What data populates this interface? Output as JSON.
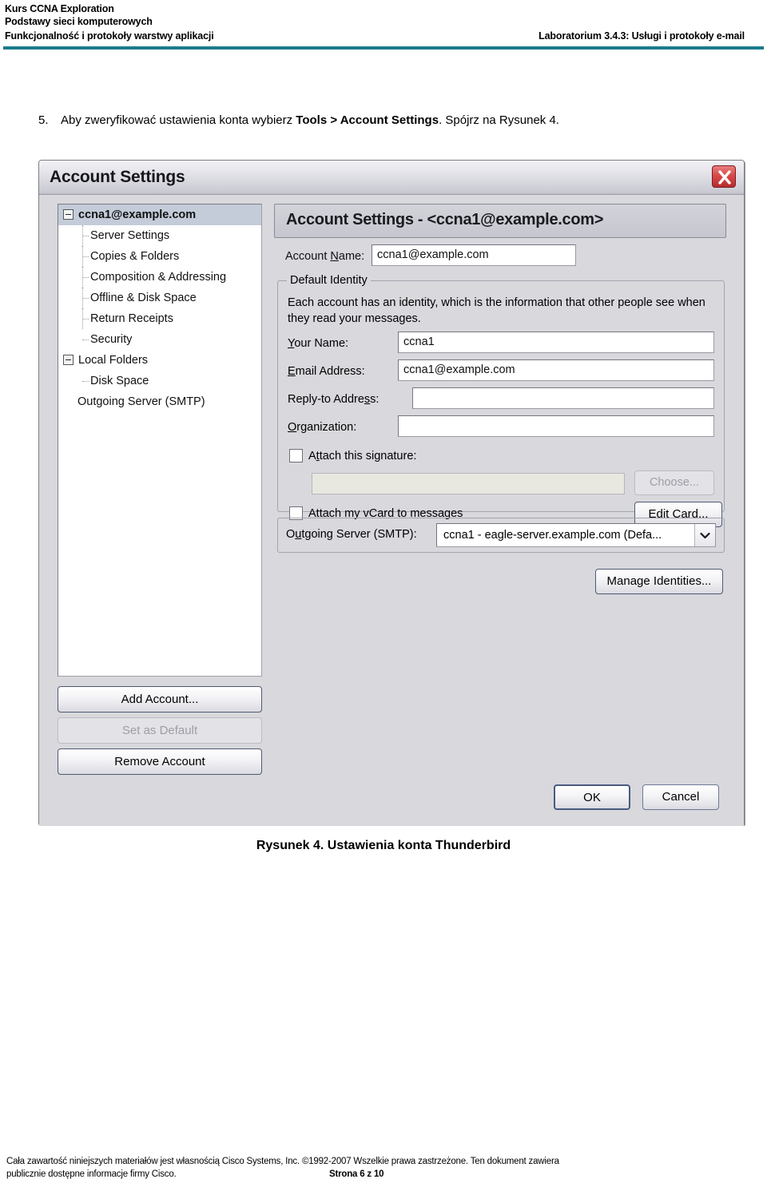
{
  "header": {
    "line1": "Kurs CCNA Exploration",
    "line2": "Podstawy sieci komputerowych",
    "line3": "Funkcjonalność i protokoły warstwy aplikacji",
    "right": "Laboratorium 3.4.3: Usługi i protokoły e-mail",
    "rule_color": "#1b7b8c"
  },
  "step": {
    "number": "5.",
    "text_before": "Aby zweryfikować ustawienia konta wybierz ",
    "emphasis": "Tools > Account Settings",
    "text_after": ". Spójrz na Rysunek 4."
  },
  "dialog": {
    "title": "Account Settings",
    "close_icon": "close-icon",
    "tree": {
      "items": [
        {
          "label": "ccna1@example.com",
          "level": 0,
          "expander": true,
          "selected": true
        },
        {
          "label": "Server Settings",
          "level": 1,
          "expander": false,
          "selected": false
        },
        {
          "label": "Copies & Folders",
          "level": 1,
          "expander": false,
          "selected": false
        },
        {
          "label": "Composition & Addressing",
          "level": 1,
          "expander": false,
          "selected": false
        },
        {
          "label": "Offline & Disk Space",
          "level": 1,
          "expander": false,
          "selected": false
        },
        {
          "label": "Return Receipts",
          "level": 1,
          "expander": false,
          "selected": false
        },
        {
          "label": "Security",
          "level": 1,
          "expander": false,
          "selected": false
        },
        {
          "label": "Local Folders",
          "level": 0,
          "expander": true,
          "selected": false
        },
        {
          "label": "Disk Space",
          "level": 1,
          "expander": false,
          "selected": false
        },
        {
          "label": "Outgoing Server (SMTP)",
          "level": 0,
          "expander": false,
          "selected": false
        }
      ]
    },
    "left_buttons": {
      "add_account": "Add Account...",
      "set_as_default": "Set as Default",
      "remove_account": "Remove Account"
    },
    "pane": {
      "header": "Account Settings - <ccna1@example.com>",
      "account_name_label": "Account Name:",
      "account_name_value": "ccna1@example.com"
    },
    "identity": {
      "legend": "Default Identity",
      "description": "Each account has an identity, which is the information that other people see when they read your messages.",
      "your_name_label": "Your Name:",
      "your_name_value": "ccna1",
      "email_label": "Email Address:",
      "email_value": "ccna1@example.com",
      "replyto_label": "Reply-to Address:",
      "replyto_value": "",
      "organization_label": "Organization:",
      "organization_value": "",
      "signature_checkbox_label": "Attach this signature:",
      "signature_value": "",
      "choose_button": "Choose...",
      "vcard_checkbox_label": "Attach my vCard to messages",
      "edit_card_button": "Edit Card..."
    },
    "smtp": {
      "label": "Outgoing Server (SMTP):",
      "value": "ccna1 - eagle-server.example.com (Defa...",
      "arrow_icon": "chevron-down-icon"
    },
    "manage_identities_button": "Manage Identities...",
    "ok_button": "OK",
    "cancel_button": "Cancel"
  },
  "caption": "Rysunek 4. Ustawienia konta Thunderbird",
  "footer": {
    "line1": "Cała zawartość niniejszych materiałów jest własnością Cisco Systems, Inc. ©1992-2007 Wszelkie prawa zastrzeżone. Ten dokument zawiera",
    "line2": "publicznie dostępne informacje firmy Cisco.",
    "page": "Strona 6  z 10"
  }
}
